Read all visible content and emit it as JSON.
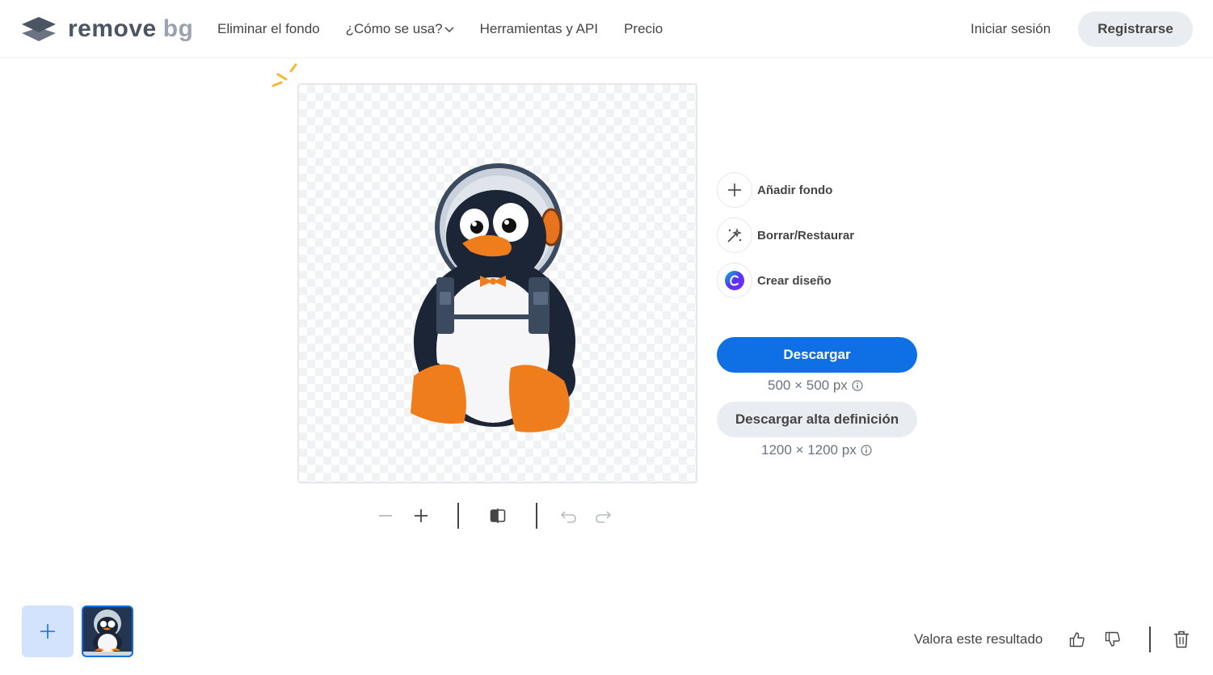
{
  "header": {
    "logo": {
      "word1": "remove",
      "word2": "bg"
    },
    "nav": [
      {
        "label": "Eliminar el fondo"
      },
      {
        "label": "¿Cómo se usa?",
        "has_dropdown": true
      },
      {
        "label": "Herramientas y API"
      },
      {
        "label": "Precio"
      }
    ],
    "login_label": "Iniciar sesión",
    "register_label": "Registrarse"
  },
  "editor": {
    "toolbar_icons": [
      "zoom-out-icon",
      "zoom-in-icon",
      "compare-icon",
      "undo-icon",
      "redo-icon"
    ],
    "actions": [
      {
        "label": "Añadir fondo",
        "icon": "plus-icon"
      },
      {
        "label": "Borrar/Restaurar",
        "icon": "magic-brush-icon"
      },
      {
        "label": "Crear diseño",
        "icon": "canva-icon"
      }
    ],
    "download": {
      "label": "Descargar",
      "size": "500 × 500 px"
    },
    "download_hd": {
      "label": "Descargar alta definición",
      "size": "1200 × 1200 px"
    }
  },
  "footer": {
    "rate_label": "Valora este resultado"
  },
  "colors": {
    "primary": "#0f70e6",
    "secondary_button": "#e9ecf0",
    "text": "#454545",
    "add_tile": "#d3e3fd"
  }
}
